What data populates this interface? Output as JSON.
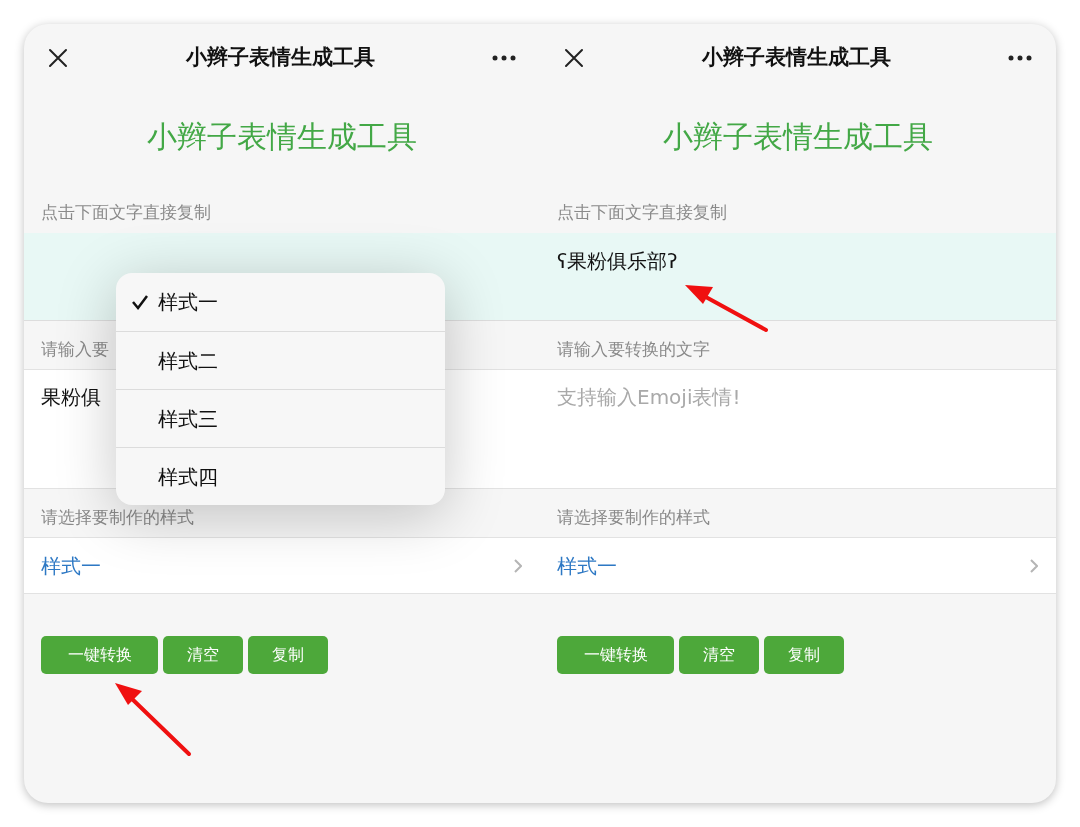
{
  "panels": [
    {
      "header": {
        "title": "小辫子表情生成工具"
      },
      "app_title": "小辫子表情生成工具",
      "output": {
        "label": "点击下面文字直接复制"
      },
      "input": {
        "label": "请输入要",
        "value": "果粉俱"
      },
      "style_select": {
        "label": "请选择要制作的样式",
        "value": "样式一"
      },
      "buttons": [
        "一键转换",
        "清空",
        "复制"
      ],
      "menu": {
        "items": [
          {
            "label": "样式一",
            "selected": true
          },
          {
            "label": "样式二",
            "selected": false
          },
          {
            "label": "样式三",
            "selected": false
          },
          {
            "label": "样式四",
            "selected": false
          }
        ]
      }
    },
    {
      "header": {
        "title": "小辫子表情生成工具"
      },
      "app_title": "小辫子表情生成工具",
      "output": {
        "label": "点击下面文字直接复制",
        "text": "ʕ果粉俱乐部ʔ"
      },
      "input": {
        "label": "请输入要转换的文字",
        "placeholder": "支持输入Emoji表情!"
      },
      "style_select": {
        "label": "请选择要制作的样式",
        "value": "样式一"
      },
      "buttons": [
        "一键转换",
        "清空",
        "复制"
      ]
    }
  ]
}
